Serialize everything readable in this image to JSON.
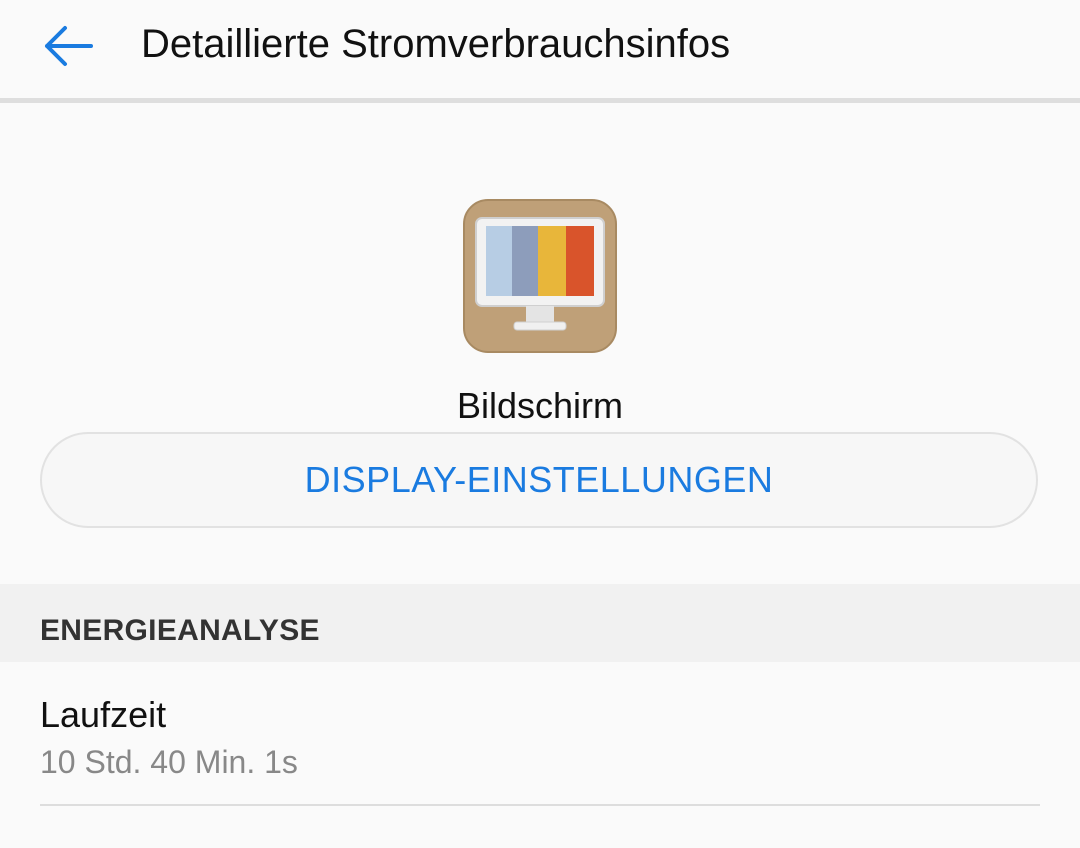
{
  "header": {
    "title": "Detaillierte Stromverbrauchsinfos",
    "back_icon": "arrow-left-icon"
  },
  "app": {
    "name": "Bildschirm",
    "icon": "display-monitor-icon"
  },
  "actions": {
    "display_settings_label": "DISPLAY-EINSTELLUNGEN"
  },
  "section": {
    "title": "ENERGIEANALYSE"
  },
  "runtime": {
    "label": "Laufzeit",
    "value": "10 Std. 40 Min. 1s"
  },
  "colors": {
    "accent": "#1a7be0",
    "background": "#fafafa",
    "section_background": "#f1f1f1"
  }
}
